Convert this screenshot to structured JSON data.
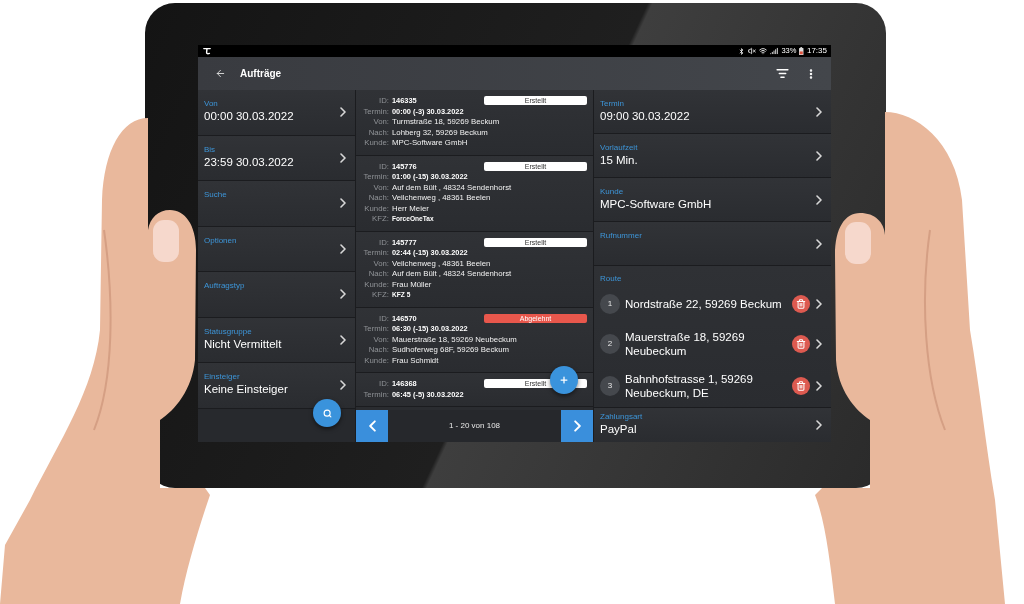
{
  "status_bar": {
    "battery": "33%",
    "time": "17:35"
  },
  "toolbar": {
    "title": "Aufträge"
  },
  "filters": [
    {
      "label": "Von",
      "value": "00:00 30.03.2022"
    },
    {
      "label": "Bis",
      "value": "23:59 30.03.2022"
    },
    {
      "label": "Suche"
    },
    {
      "label": "Optionen"
    },
    {
      "label": "Auftragstyp"
    },
    {
      "label": "Statusgruppe",
      "value": "Nicht Vermittelt"
    },
    {
      "label": "Einsteiger",
      "value": "Keine Einsteiger"
    }
  ],
  "orders": [
    {
      "status": {
        "kind": "created",
        "label": "Erstellt"
      },
      "fields": [
        {
          "label": "ID:",
          "value": "146335",
          "kind": "strong"
        },
        {
          "label": "Termin:",
          "value": "00:00 (-3) 30.03.2022",
          "kind": "strong"
        },
        {
          "label": "Von:",
          "value": "Turmstraße 18, 59269 Beckum",
          "kind": "plain"
        },
        {
          "label": "Nach:",
          "value": "Lohberg 32, 59269 Beckum",
          "kind": "plain"
        },
        {
          "label": "Kunde:",
          "value": "MPC-Software GmbH",
          "kind": "plain"
        }
      ]
    },
    {
      "status": {
        "kind": "created",
        "label": "Erstellt"
      },
      "fields": [
        {
          "label": "ID:",
          "value": "145776",
          "kind": "strong"
        },
        {
          "label": "Termin:",
          "value": "01:00 (-15) 30.03.2022",
          "kind": "strong"
        },
        {
          "label": "Von:",
          "value": "Auf dem Bült , 48324 Sendenhorst",
          "kind": "plain"
        },
        {
          "label": "Nach:",
          "value": "Veilchenweg , 48361 Beelen",
          "kind": "plain"
        },
        {
          "label": "Kunde:",
          "value": "Herr Meier",
          "kind": "plain"
        },
        {
          "label": "KFZ:",
          "value": "ForceOneTax",
          "kind": "plate"
        }
      ]
    },
    {
      "status": {
        "kind": "created",
        "label": "Erstellt"
      },
      "fields": [
        {
          "label": "ID:",
          "value": "145777",
          "kind": "strong"
        },
        {
          "label": "Termin:",
          "value": "02:44 (-15) 30.03.2022",
          "kind": "strong"
        },
        {
          "label": "Von:",
          "value": "Veilchenweg , 48361 Beelen",
          "kind": "plain"
        },
        {
          "label": "Nach:",
          "value": "Auf dem Bült , 48324 Sendenhorst",
          "kind": "plain"
        },
        {
          "label": "Kunde:",
          "value": "Frau Müller",
          "kind": "plain"
        },
        {
          "label": "KFZ:",
          "value": "KFZ 5",
          "kind": "plate"
        }
      ]
    },
    {
      "status": {
        "kind": "rejected",
        "label": "Abgelehnt"
      },
      "fields": [
        {
          "label": "ID:",
          "value": "146570",
          "kind": "strong"
        },
        {
          "label": "Termin:",
          "value": "06:30 (-15) 30.03.2022",
          "kind": "strong"
        },
        {
          "label": "Von:",
          "value": "Mauerstraße 18, 59269 Neubeckum",
          "kind": "plain"
        },
        {
          "label": "Nach:",
          "value": "Sudhoferweg 68F, 59269 Beckum",
          "kind": "plain"
        },
        {
          "label": "Kunde:",
          "value": "Frau Schmidt",
          "kind": "plain"
        }
      ]
    },
    {
      "status": {
        "kind": "created",
        "label": "Erstellt"
      },
      "fields": [
        {
          "label": "ID:",
          "value": "146368",
          "kind": "strong"
        },
        {
          "label": "Termin:",
          "value": "06:45 (-5) 30.03.2022",
          "kind": "strong"
        }
      ]
    }
  ],
  "pagination": {
    "range": "1 - 20 von 108"
  },
  "details": {
    "fields": [
      {
        "label": "Termin",
        "value": "09:00 30.03.2022"
      },
      {
        "label": "Vorlaufzeit",
        "value": "15 Min."
      },
      {
        "label": "Kunde",
        "value": "MPC-Software GmbH"
      },
      {
        "label": "Rufnummer"
      }
    ],
    "route": {
      "label": "Route",
      "stops": [
        {
          "number": "1",
          "address": "Nordstraße 22, 59269 Beckum"
        },
        {
          "number": "2",
          "address": "Mauerstraße 18, 59269 Neubeckum"
        },
        {
          "number": "3",
          "address": "Bahnhofstrasse 1, 59269 Neubeckum, DE"
        }
      ]
    },
    "payment": {
      "label": "Zahlungsart",
      "value": "PayPal"
    }
  }
}
